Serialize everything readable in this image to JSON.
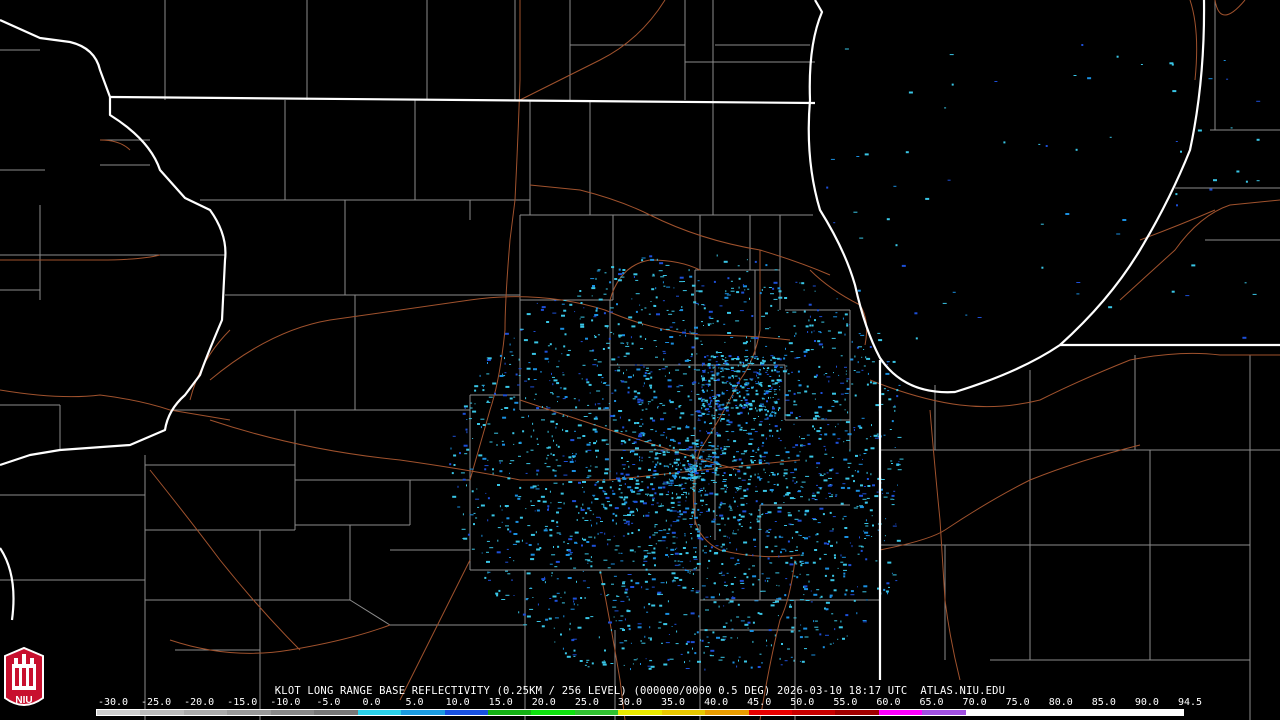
{
  "product": {
    "caption": "KLOT LONG RANGE BASE REFLECTIVITY (0.25KM / 256 LEVEL) (000000/0000 0.5 DEG) 2026-03-10 18:17 UTC  ATLAS.NIU.EDU"
  },
  "colorbar": {
    "ticks": [
      "-30.0",
      "-25.0",
      "-20.0",
      "-15.0",
      "-10.0",
      "-5.0",
      "0.0",
      "5.0",
      "10.0",
      "15.0",
      "20.0",
      "25.0",
      "30.0",
      "35.0",
      "40.0",
      "45.0",
      "50.0",
      "55.0",
      "60.0",
      "65.0",
      "70.0",
      "75.0",
      "80.0",
      "85.0",
      "90.0",
      "94.5"
    ],
    "colors": [
      "#cccccc",
      "#bbbbbb",
      "#aaaaaa",
      "#999999",
      "#888888",
      "#777777",
      "#2ad0e8",
      "#1a9ae0",
      "#1850e0",
      "#14b014",
      "#0ee00e",
      "#30c030",
      "#e8e800",
      "#e8c800",
      "#e89c00",
      "#e80000",
      "#c80000",
      "#a00000",
      "#ff00ff",
      "#a050e0",
      "#ffffff",
      "#ffffff",
      "#ffffff",
      "#ffffff",
      "#ffffff"
    ]
  },
  "logo": {
    "text": "NIU"
  },
  "colors": {
    "background": "#000000",
    "state_border": "#ffffff",
    "county_border": "#8c8c8c",
    "highway": "#a0522d",
    "echo_light": "#39c6e6",
    "echo_mid": "#1a8fe0",
    "echo_dark": "#1d4fd8"
  }
}
